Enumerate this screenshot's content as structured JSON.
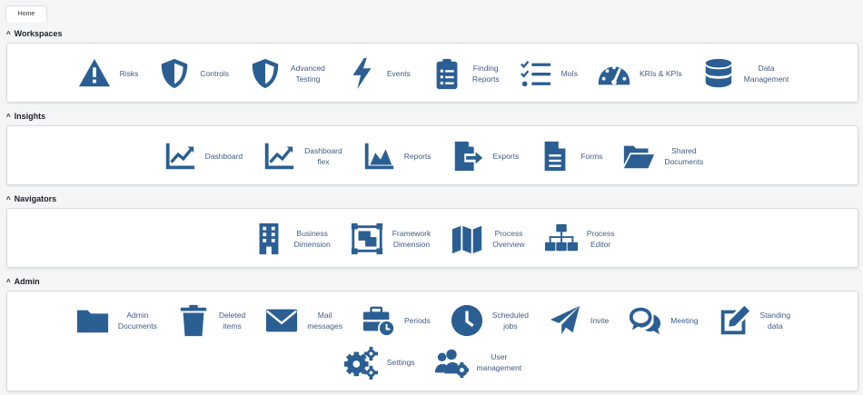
{
  "tabs": [
    {
      "label": "Home"
    }
  ],
  "sections": {
    "workspaces": {
      "title": "Workspaces",
      "items": [
        {
          "label": "Risks",
          "icon": "warning-icon"
        },
        {
          "label": "Controls",
          "icon": "shield-icon"
        },
        {
          "label": "Advanced\nTesting",
          "icon": "shield-icon"
        },
        {
          "label": "Events",
          "icon": "lightning-icon"
        },
        {
          "label": "Finding\nReports",
          "icon": "clipboard-list-icon"
        },
        {
          "label": "MoIs",
          "icon": "checklist-icon"
        },
        {
          "label": "KRIs & KPIs",
          "icon": "gauge-icon"
        },
        {
          "label": "Data\nManagement",
          "icon": "database-icon"
        }
      ]
    },
    "insights": {
      "title": "Insights",
      "items": [
        {
          "label": "Dashboard",
          "icon": "line-chart-icon"
        },
        {
          "label": "Dashboard\nflex",
          "icon": "line-chart-icon"
        },
        {
          "label": "Reports",
          "icon": "area-chart-icon"
        },
        {
          "label": "Exports",
          "icon": "file-export-icon"
        },
        {
          "label": "Forms",
          "icon": "document-icon"
        },
        {
          "label": "Shared\nDocuments",
          "icon": "open-folder-icon"
        }
      ]
    },
    "navigators": {
      "title": "Navigators",
      "items": [
        {
          "label": "Business\nDimension",
          "icon": "building-icon"
        },
        {
          "label": "Framework\nDimension",
          "icon": "object-group-icon"
        },
        {
          "label": "Process\nOverview",
          "icon": "map-icon"
        },
        {
          "label": "Process\nEditor",
          "icon": "sitemap-icon"
        }
      ]
    },
    "admin": {
      "title": "Admin",
      "items_row1": [
        {
          "label": "Admin\nDocuments",
          "icon": "folder-icon"
        },
        {
          "label": "Deleted\nitems",
          "icon": "trash-icon"
        },
        {
          "label": "Mail\nmessages",
          "icon": "envelope-icon"
        },
        {
          "label": "Periods",
          "icon": "briefcase-clock-icon"
        },
        {
          "label": "Scheduled\njobs",
          "icon": "clock-icon"
        },
        {
          "label": "Invite",
          "icon": "paper-plane-icon"
        },
        {
          "label": "Meeting",
          "icon": "comments-icon"
        },
        {
          "label": "Standing\ndata",
          "icon": "edit-icon"
        }
      ],
      "items_row2": [
        {
          "label": "Settings",
          "icon": "cogs-icon"
        },
        {
          "label": "User\nmanagement",
          "icon": "users-cog-icon"
        }
      ]
    }
  },
  "colors": {
    "icon": "#2b5f93",
    "label": "#3f5b86",
    "accent": "#1d2129"
  }
}
